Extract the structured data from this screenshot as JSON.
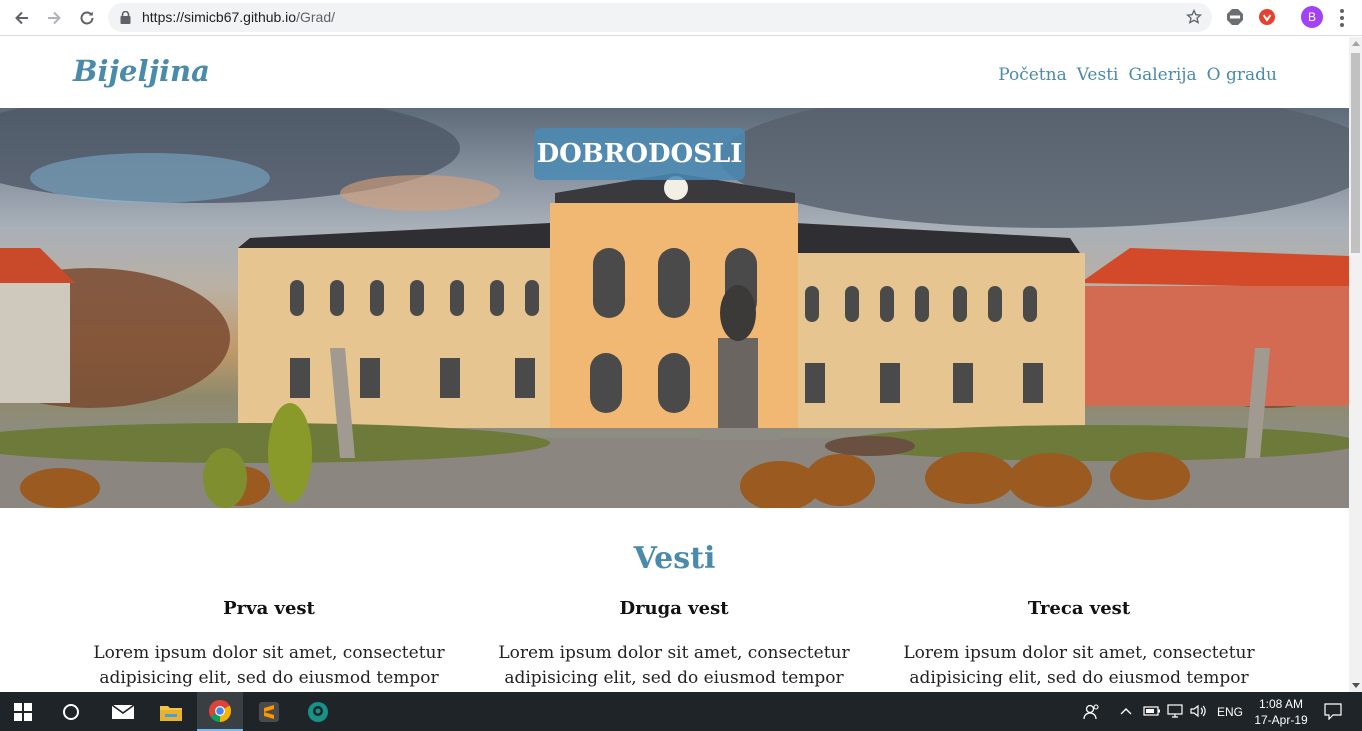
{
  "browser": {
    "url_host": "https://simicb67.github.io",
    "url_path": "/Grad/",
    "profile_initial": "B"
  },
  "site": {
    "logo": "Bijeljina",
    "nav": [
      "Početna",
      "Vesti",
      "Galerija",
      "O gradu"
    ],
    "hero_title": "DOBRODOSLI",
    "news_title": "Vesti",
    "news": [
      {
        "title": "Prva vest",
        "text": "Lorem ipsum dolor sit amet, consectetur adipisicing elit, sed do eiusmod tempor"
      },
      {
        "title": "Druga vest",
        "text": "Lorem ipsum dolor sit amet, consectetur adipisicing elit, sed do eiusmod tempor"
      },
      {
        "title": "Treca vest",
        "text": "Lorem ipsum dolor sit amet, consectetur adipisicing elit, sed do eiusmod tempor"
      }
    ]
  },
  "taskbar": {
    "language": "ENG",
    "time": "1:08 AM",
    "date": "17-Apr-19"
  },
  "colors": {
    "accent": "#4a8aaa",
    "taskbar": "#1f2428",
    "profile": "#a142f4"
  }
}
